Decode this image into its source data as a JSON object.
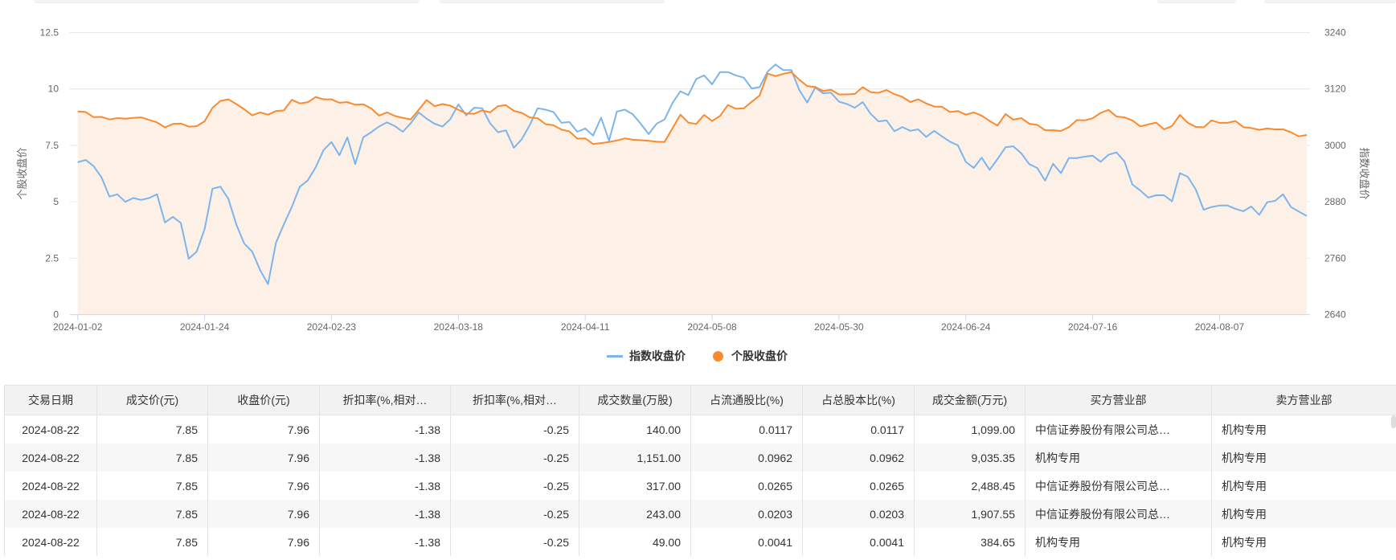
{
  "colors": {
    "index_line": "#7cb5ec",
    "stock_line": "#fb8a2e",
    "stock_area": "#fdf1e7",
    "grid": "#e6e6e6"
  },
  "chart_data": {
    "type": "line",
    "title": "",
    "x_start": "2024-01-02",
    "x_end": "2024-08-22",
    "x_tick_labels": [
      "2024-01-02",
      "2024-01-24",
      "2024-02-23",
      "2024-03-18",
      "2024-04-11",
      "2024-05-08",
      "2024-05-30",
      "2024-06-24",
      "2024-07-16",
      "2024-08-07"
    ],
    "x_tick_interval": 16,
    "left_axis": {
      "label": "个股收盘价",
      "ylim": [
        0,
        12.5
      ],
      "ticks": [
        "0",
        "2.5",
        "5",
        "7.5",
        "10",
        "12.5"
      ]
    },
    "right_axis": {
      "label": "指数收盘价",
      "ylim": [
        2640,
        3240
      ],
      "ticks": [
        "2640",
        "2760",
        "2880",
        "3000",
        "3120",
        "3240"
      ]
    },
    "grid": true,
    "legend_position": "bottom-center",
    "series": [
      {
        "name": "指数收盘价",
        "axis": "right",
        "marker": "line",
        "values": [
          2964,
          2969,
          2956,
          2932,
          2891,
          2896,
          2880,
          2888,
          2884,
          2888,
          2896,
          2836,
          2848,
          2835,
          2759,
          2774,
          2822,
          2908,
          2912,
          2886,
          2832,
          2791,
          2774,
          2735,
          2705,
          2793,
          2832,
          2869,
          2912,
          2925,
          2953,
          2990,
          3007,
          2979,
          3017,
          2960,
          3017,
          3028,
          3040,
          3049,
          3041,
          3029,
          3047,
          3070,
          3057,
          3046,
          3040,
          3056,
          3087,
          3064,
          3080,
          3079,
          3047,
          3028,
          3032,
          2995,
          3013,
          3043,
          3079,
          3076,
          3071,
          3048,
          3050,
          3029,
          3036,
          3021,
          3059,
          3010,
          3072,
          3076,
          3066,
          3046,
          3024,
          3046,
          3055,
          3090,
          3115,
          3107,
          3141,
          3149,
          3130,
          3156,
          3156,
          3149,
          3144,
          3121,
          3124,
          3157,
          3172,
          3160,
          3160,
          3118,
          3091,
          3123,
          3111,
          3112,
          3093,
          3088,
          3080,
          3092,
          3067,
          3051,
          3053,
          3030,
          3039,
          3031,
          3034,
          3018,
          3031,
          3019,
          3008,
          3000,
          2965,
          2952,
          2974,
          2948,
          2971,
          2996,
          2998,
          2983,
          2960,
          2952,
          2925,
          2961,
          2941,
          2973,
          2973,
          2976,
          2978,
          2965,
          2980,
          2985,
          2966,
          2917,
          2904,
          2889,
          2894,
          2894,
          2881,
          2941,
          2933,
          2906,
          2863,
          2869,
          2872,
          2872,
          2865,
          2860,
          2870,
          2852,
          2879,
          2882,
          2896,
          2869,
          2859,
          2850
        ]
      },
      {
        "name": "个股收盘价",
        "axis": "left",
        "marker": "circle",
        "area": true,
        "values": [
          9.0,
          8.98,
          8.75,
          8.76,
          8.65,
          8.71,
          8.68,
          8.72,
          8.74,
          8.63,
          8.52,
          8.3,
          8.45,
          8.47,
          8.33,
          8.35,
          8.57,
          9.16,
          9.47,
          9.54,
          9.33,
          9.1,
          8.83,
          8.96,
          8.86,
          9.02,
          9.05,
          9.52,
          9.36,
          9.41,
          9.64,
          9.54,
          9.54,
          9.39,
          9.42,
          9.3,
          9.32,
          9.14,
          8.82,
          8.96,
          8.8,
          8.72,
          8.65,
          9.08,
          9.51,
          9.24,
          9.33,
          9.26,
          9.08,
          8.91,
          8.9,
          9.05,
          8.96,
          9.24,
          9.28,
          9.03,
          8.94,
          8.74,
          8.7,
          8.44,
          8.39,
          8.2,
          8.12,
          7.8,
          7.81,
          7.56,
          7.6,
          7.65,
          7.72,
          7.81,
          7.75,
          7.73,
          7.7,
          7.66,
          7.65,
          8.25,
          8.86,
          8.51,
          8.45,
          8.85,
          8.58,
          8.8,
          9.29,
          9.12,
          9.14,
          9.43,
          9.71,
          10.68,
          10.57,
          10.67,
          10.75,
          10.41,
          10.13,
          10.09,
          9.91,
          9.96,
          9.76,
          9.76,
          9.78,
          10.08,
          9.86,
          9.83,
          9.95,
          9.77,
          9.65,
          9.42,
          9.54,
          9.36,
          9.22,
          9.21,
          8.98,
          9.02,
          8.86,
          8.96,
          8.82,
          8.58,
          8.38,
          8.89,
          8.64,
          8.71,
          8.46,
          8.41,
          8.17,
          8.17,
          8.14,
          8.31,
          8.62,
          8.61,
          8.7,
          8.94,
          9.07,
          8.78,
          8.74,
          8.61,
          8.34,
          8.43,
          8.51,
          8.21,
          8.36,
          8.85,
          8.5,
          8.32,
          8.3,
          8.61,
          8.5,
          8.5,
          8.58,
          8.31,
          8.27,
          8.19,
          8.25,
          8.21,
          8.21,
          8.08,
          7.9,
          7.96
        ]
      }
    ]
  },
  "legend": {
    "index": "指数收盘价",
    "stock": "个股收盘价"
  },
  "table": {
    "headers": [
      "交易日期",
      "成交价(元)",
      "收盘价(元)",
      "折扣率(%,相对…",
      "折扣率(%,相对…",
      "成交数量(万股)",
      "占流通股比(%)",
      "占总股本比(%)",
      "成交金额(万元)",
      "买方营业部",
      "卖方营业部"
    ],
    "rows": [
      [
        "2024-08-22",
        "7.85",
        "7.96",
        "-1.38",
        "-0.25",
        "140.00",
        "0.0117",
        "0.0117",
        "1,099.00",
        "中信证券股份有限公司总…",
        "机构专用"
      ],
      [
        "2024-08-22",
        "7.85",
        "7.96",
        "-1.38",
        "-0.25",
        "1,151.00",
        "0.0962",
        "0.0962",
        "9,035.35",
        "机构专用",
        "机构专用"
      ],
      [
        "2024-08-22",
        "7.85",
        "7.96",
        "-1.38",
        "-0.25",
        "317.00",
        "0.0265",
        "0.0265",
        "2,488.45",
        "中信证券股份有限公司总…",
        "机构专用"
      ],
      [
        "2024-08-22",
        "7.85",
        "7.96",
        "-1.38",
        "-0.25",
        "243.00",
        "0.0203",
        "0.0203",
        "1,907.55",
        "中信证券股份有限公司总…",
        "机构专用"
      ],
      [
        "2024-08-22",
        "7.85",
        "7.96",
        "-1.38",
        "-0.25",
        "49.00",
        "0.0041",
        "0.0041",
        "384.65",
        "机构专用",
        "机构专用"
      ]
    ]
  }
}
